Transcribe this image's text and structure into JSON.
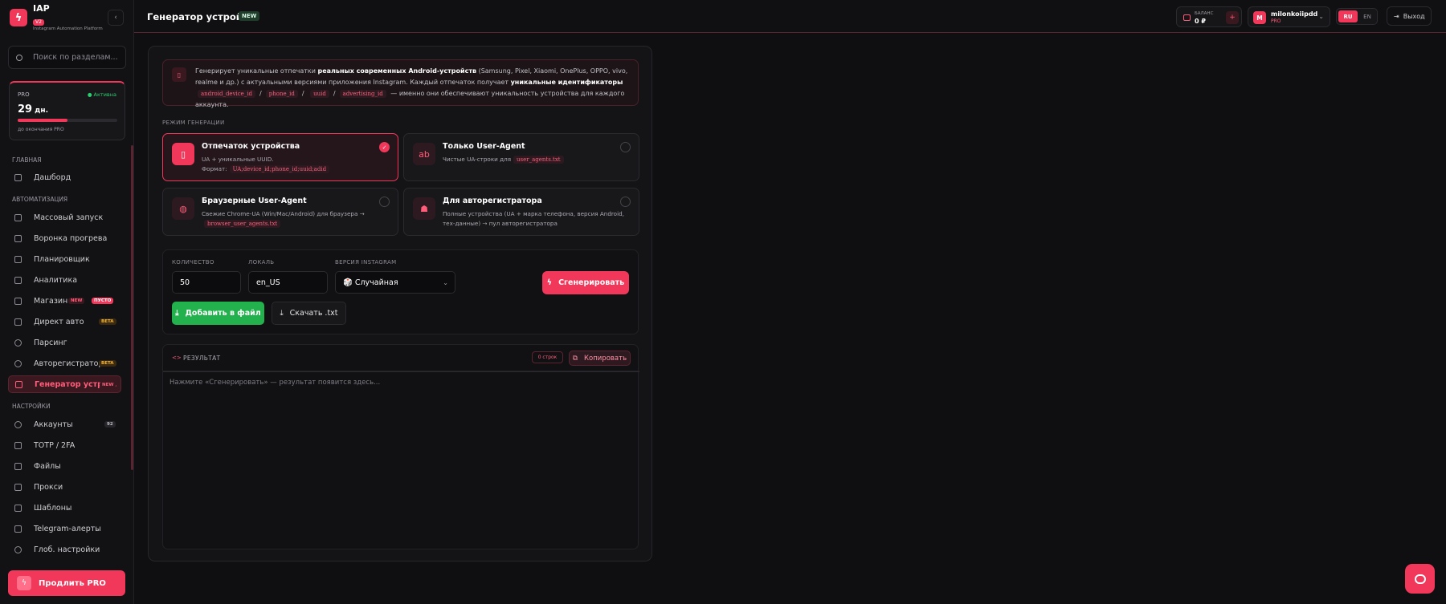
{
  "brand": {
    "name": "IAP",
    "version": "V2",
    "subtitle": "Instagram Automation Platform",
    "logo_icon": "bolt-icon"
  },
  "sidebar": {
    "search_placeholder": "Поиск по разделам...",
    "pro": {
      "label": "PRO",
      "status": "● Активна",
      "days": "29",
      "days_unit": "дн.",
      "progress": 0.5,
      "note": "до окончания PRO"
    },
    "sections": {
      "main": "ГЛАВНАЯ",
      "automation": "АВТОМАТИЗАЦИЯ",
      "settings": "НАСТРОЙКИ"
    },
    "items": [
      {
        "label": "Дашборд",
        "icon": "grid-icon"
      },
      {
        "label": "Массовый запуск",
        "icon": "play-icon"
      },
      {
        "label": "Воронка прогрева",
        "icon": "flame-icon"
      },
      {
        "label": "Планировщик",
        "icon": "calendar-icon"
      },
      {
        "label": "Аналитика",
        "icon": "bar-chart-icon"
      },
      {
        "label": "Магазин",
        "icon": "shop-icon",
        "badges": [
          "NEW",
          "ПУСТО"
        ]
      },
      {
        "label": "Директ авто",
        "icon": "mail-icon",
        "badges": [
          "BETA"
        ]
      },
      {
        "label": "Парсинг",
        "icon": "search-icon"
      },
      {
        "label": "Авторегистратор",
        "icon": "user-plus-icon",
        "badges": [
          "BETA"
        ]
      },
      {
        "label": "Генератор устро...",
        "icon": "phone-icon",
        "badges": [
          "NEW"
        ]
      },
      {
        "label": "Аккаунты",
        "icon": "users-icon",
        "badges": [
          "92"
        ]
      },
      {
        "label": "TOTP / 2FA",
        "icon": "lock-icon"
      },
      {
        "label": "Файлы",
        "icon": "folder-icon"
      },
      {
        "label": "Прокси",
        "icon": "layers-icon"
      },
      {
        "label": "Шаблоны",
        "icon": "template-icon"
      },
      {
        "label": "Telegram-алерты",
        "icon": "chat-icon"
      },
      {
        "label": "Глоб. настройки",
        "icon": "gear-icon"
      }
    ],
    "renew_label": "Продлить PRO"
  },
  "header": {
    "title": "Генератор устройств",
    "title_badge": "NEW",
    "balance_label": "БАЛАНС",
    "balance_value": "0 ₽",
    "user_initial": "M",
    "user_name": "milonkoiipdd",
    "user_plan": "PRO",
    "lang_ru": "RU",
    "lang_en": "EN",
    "logout": "Выход"
  },
  "info": {
    "t1": "Генерирует уникальные отпечатки ",
    "b1": "реальных современных Android-устройств",
    "t2": " (Samsung, Pixel, Xiaomi, OnePlus, OPPO, vivo, realme и др.) с актуальными версиями приложения Instagram. Каждый отпечаток получает ",
    "b2": "уникальные идентификаторы",
    "c1": "android_device_id",
    "c2": "phone_id",
    "c3": "uuid",
    "c4": "advertising_id",
    "t3": " — именно они обеспечивают уникальность устройства для каждого аккаунта.",
    "slash": "/"
  },
  "mode_label": "РЕЖИМ ГЕНЕРАЦИИ",
  "modes": [
    {
      "title": "Отпечаток устройства",
      "desc": "UA + уникальные UUID.",
      "desc2": "Формат:",
      "code": "UA;device_id;phone_id;uuid;adid",
      "selected": true
    },
    {
      "title": "Только User-Agent",
      "desc": "Чистые UA-строки для",
      "code": "user_agents.txt"
    },
    {
      "title": "Браузерные User-Agent",
      "desc": "Свежие Chrome-UA (Win/Mac/Android) для браузера →",
      "code": "browser_user_agents.txt"
    },
    {
      "title": "Для авторегистратора",
      "desc": "Полные устройства (UA + марка телефона, версия Android, тех-данные) → пул авторегистратора"
    }
  ],
  "controls": {
    "qty_label": "КОЛИЧЕСТВО",
    "qty_value": "50",
    "locale_label": "ЛОКАЛЬ",
    "locale_value": "en_US",
    "version_label": "ВЕРСИЯ INSTAGRAM",
    "version_value": "🎲 Случайная",
    "generate": "Сгенерировать",
    "add_to_file": "Добавить в файл",
    "download": "Скачать .txt"
  },
  "result": {
    "title": "РЕЗУЛЬТАТ",
    "lines": "0 строк",
    "copy": "Копировать",
    "placeholder": "Нажмите «Сгенерировать» — результат появится здесь..."
  },
  "colors": {
    "accent": "#f2385a",
    "success": "#22b14c",
    "beta": "#f0b43c"
  }
}
